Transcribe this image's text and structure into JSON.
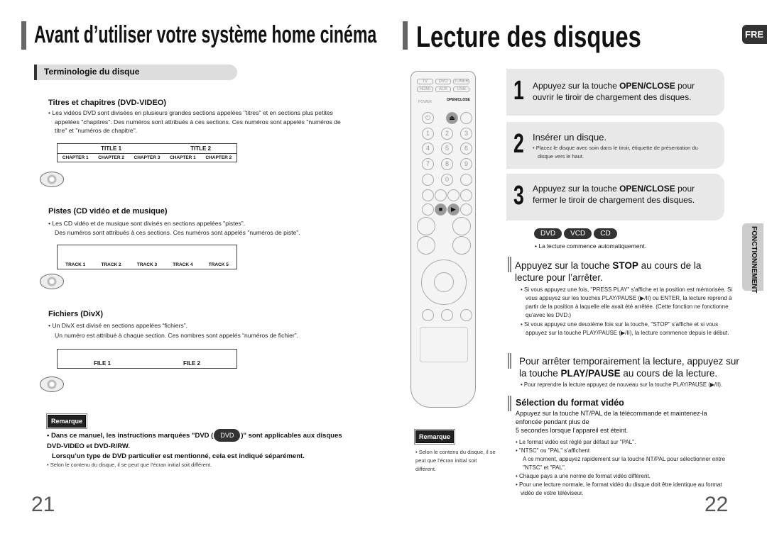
{
  "left": {
    "title": "Avant d’utiliser votre système home cinéma",
    "section": "Terminologie du disque",
    "titres": {
      "heading": "Titres et chapitres (DVD-VIDEO)",
      "text": "Les vidéos DVD sont divisées en plusieurs grandes sections appelées \"titres\" et en sections plus petites appelées \"chapitres\". Des numéros sont attribués à ces sections. Ces numéros sont appelés \"numéros de titre\" et \"numéros de chapitre\".",
      "titles": [
        "TITLE 1",
        "TITLE 2"
      ],
      "chapters": [
        "CHAPTER 1",
        "CHAPTER 2",
        "CHAPTER 3",
        "CHAPTER 1",
        "CHAPTER 2"
      ]
    },
    "pistes": {
      "heading": "Pistes (CD vidéo et de musique)",
      "text1": "Les CD vidéo et de musique sont divisés en sections appelées \"pistes\".",
      "text2": "Des numéros sont attribués à ces sections. Ces numéros sont appelés \"numéros de piste\".",
      "tracks": [
        "TRACK 1",
        "TRACK 2",
        "TRACK 3",
        "TRACK 4",
        "TRACK 5"
      ]
    },
    "fichiers": {
      "heading": "Fichiers (DivX)",
      "text1": "Un DivX est divisé en sections appelées “fichiers”.",
      "text2": "Un numéro est attribué à chaque section. Ces nombres sont appelés “numéros de fichier”.",
      "files": [
        "FILE 1",
        "FILE 2"
      ]
    },
    "remarque": {
      "label": "Remarque",
      "b1a": "Dans ce manuel, les instructions marquées \"DVD (",
      "b1badge": "DVD",
      "b1b": ")\" sont applicables aux disques DVD-VIDEO et DVD-R/RW.",
      "b1c": "Lorsqu’un type de DVD particulier est mentionné, cela est indiqué séparément.",
      "b2": "Selon le contenu du disque, il se peut que l’écran initial soit différent."
    },
    "page": "21"
  },
  "right": {
    "title": "Lecture des disques",
    "lang_tab": "FRE",
    "side_tab": "FONCTIONNEMENT",
    "remote": {
      "buttons": [
        "TV",
        "DVD",
        "TUNER",
        "HDMI",
        "AUX",
        "USB",
        "POWER",
        "OPEN/CLOSE",
        "1",
        "2",
        "3",
        "4",
        "5",
        "6",
        "7",
        "8",
        "9",
        "0"
      ]
    },
    "remarque": {
      "label": "Remarque",
      "text": "Selon le contenu du disque, il se peut que l’écran initial soit différent."
    },
    "steps": [
      {
        "num": "1",
        "a": "Appuyez sur la touche ",
        "b": "OPEN/CLOSE",
        "c": " pour ouvrir le tiroir de chargement des disques."
      },
      {
        "num": "2",
        "a": "Insérer un disque.",
        "note": "Placez le disque avec soin dans le tiroir, étiquette de présentation du disque vers le haut."
      },
      {
        "num": "3",
        "a": "Appuyez sur la touche ",
        "b": "OPEN/CLOSE",
        "c": " pour fermer le tiroir de chargement des disques."
      }
    ],
    "badges": [
      "DVD",
      "VCD",
      "CD"
    ],
    "auto": "La lecture commence automatiquement.",
    "stop": {
      "a": "Appuyez sur la touche ",
      "b": "STOP",
      "c": " au cours de la lecture pour l’arrêter.",
      "n1": "Si vous appuyez une fois, \"PRESS PLAY\" s’affiche et la position est mémorisée. Si vous appuyez sur les touches PLAY/PAUSE (▶/II) ou ENTER, la lecture reprend à partir de la position à laquelle elle avait été arrêtée. (Cette fonction ne fonctionne qu’avec les DVD.)",
      "n2": "Si vous appuyez une deuxième fois sur la touche, \"STOP\" s’affiche et si vous appuyez sur la touche PLAY/PAUSE (▶/II), la lecture commence depuis le début."
    },
    "pause": {
      "a": "Pour arrêter temporairement la lecture, appuyez sur la touche ",
      "b": "PLAY/PAUSE",
      "c": " au cours de la lecture.",
      "n1": "Pour reprendre la lecture appuyez de nouveau sur la touche PLAY/PAUSE (▶/II)."
    },
    "format": {
      "heading": "Sélection du format vidéo",
      "intro": "Appuyez sur la touche NT/PAL de la télécommande et maintenez-la enfoncée pendant plus de",
      "intro2": "5 secondes lorsque l’appareil est éteint.",
      "n1": "Le format vidéo est réglé par défaut sur \"PAL\".",
      "n2": "\"NTSC\" ou \"PAL\" s’affichent",
      "n2b": "A ce moment, appuyez rapidement sur la touche NT/PAL pour sélectionner entre \"NTSC\" et \"PAL\".",
      "n3": "Chaque pays a une norme de format vidéo différent.",
      "n4": "Pour une lecture normale, le format vidéo du disque doit être identique au format vidéo de votre téléviseur."
    },
    "page": "22"
  }
}
